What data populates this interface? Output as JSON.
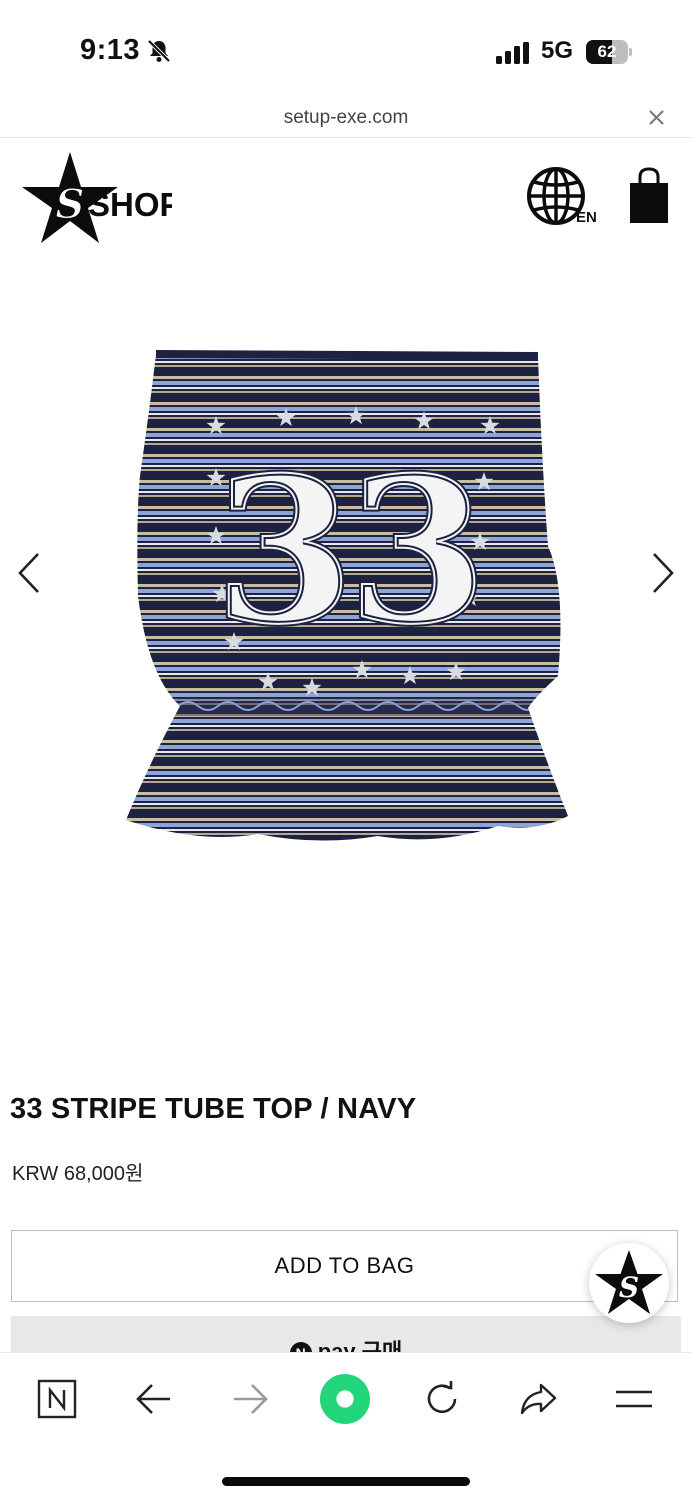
{
  "status_bar": {
    "time": "9:13",
    "network": "5G",
    "battery_percent": 62,
    "battery_label": "62",
    "icons": [
      "bell-muted-icon",
      "signal-icon",
      "battery-icon"
    ]
  },
  "browser": {
    "url": "setup-exe.com",
    "close_icon": "close-icon"
  },
  "header": {
    "logo_icon": "star-s-logo-icon",
    "logo_text": "SHOP",
    "language_icon": "globe-icon",
    "language_label": "EN",
    "bag_icon": "shopping-bag-icon"
  },
  "gallery": {
    "image_icon": "striped-tube-top-image",
    "prev_icon": "chevron-left-icon",
    "next_icon": "chevron-right-icon"
  },
  "product": {
    "title": "33 STRIPE TUBE TOP / NAVY",
    "price": "KRW 68,000원"
  },
  "actions": {
    "add_to_bag": "ADD TO BAG",
    "npay_badge": "N",
    "npay_label": "pay 구매"
  },
  "floating": {
    "icon": "star-s-chat-icon"
  },
  "toolbar": {
    "items": [
      "naver-home-icon",
      "back-icon",
      "forward-icon",
      "green-dot-icon",
      "reload-icon",
      "share-icon",
      "menu-icon"
    ]
  },
  "colors": {
    "navy": "#1c2240",
    "stripe_blue": "#8ea3d8",
    "stripe_beige": "#c8bca4",
    "green": "#22d47a"
  }
}
